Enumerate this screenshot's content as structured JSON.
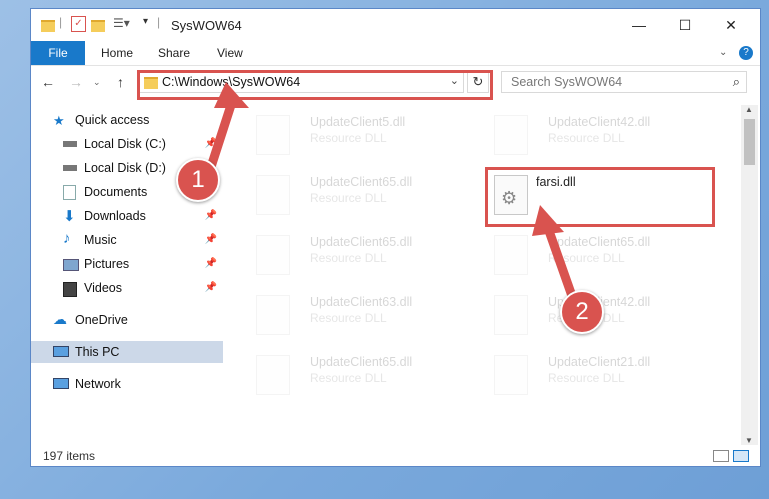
{
  "window": {
    "title": "SysWOW64"
  },
  "ribbon": {
    "file": "File",
    "home": "Home",
    "share": "Share",
    "view": "View"
  },
  "addressbar": {
    "path": "C:\\Windows\\SysWOW64",
    "search_placeholder": "Search SysWOW64"
  },
  "sidebar": {
    "items": [
      {
        "label": "Quick access",
        "icon": "star-icon"
      },
      {
        "label": "Local Disk (C:)",
        "icon": "drive-icon"
      },
      {
        "label": "Local Disk (D:)",
        "icon": "drive-icon"
      },
      {
        "label": "Documents",
        "icon": "documents-icon"
      },
      {
        "label": "Downloads",
        "icon": "download-icon"
      },
      {
        "label": "Music",
        "icon": "music-icon"
      },
      {
        "label": "Pictures",
        "icon": "pictures-icon"
      },
      {
        "label": "Videos",
        "icon": "videos-icon"
      },
      {
        "label": "OneDrive",
        "icon": "cloud-icon"
      },
      {
        "label": "This PC",
        "icon": "pc-icon"
      },
      {
        "label": "Network",
        "icon": "network-icon"
      }
    ]
  },
  "files": [
    {
      "name": "UpdateClient5.dll",
      "type": "Resource DLL"
    },
    {
      "name": "UpdateClient42.dll",
      "type": "Resource DLL"
    },
    {
      "name": "UpdateClient65.dll",
      "type": "Resource DLL"
    },
    {
      "name": "farsi.dll",
      "type": ""
    },
    {
      "name": "UpdateClient65.dll",
      "type": "Resource DLL"
    },
    {
      "name": "UpdateClient65.dll",
      "type": "Resource DLL"
    },
    {
      "name": "UpdateClient63.dll",
      "type": "Resource DLL"
    },
    {
      "name": "UpdateClient42.dll",
      "type": "Resource DLL"
    },
    {
      "name": "UpdateClient65.dll",
      "type": "Resource DLL"
    },
    {
      "name": "UpdateClient21.dll",
      "type": "Resource DLL"
    }
  ],
  "status": {
    "items": "197 items"
  },
  "callouts": {
    "one": "1",
    "two": "2"
  },
  "colors": {
    "accent": "#1979ca",
    "highlight": "#d9534f"
  }
}
